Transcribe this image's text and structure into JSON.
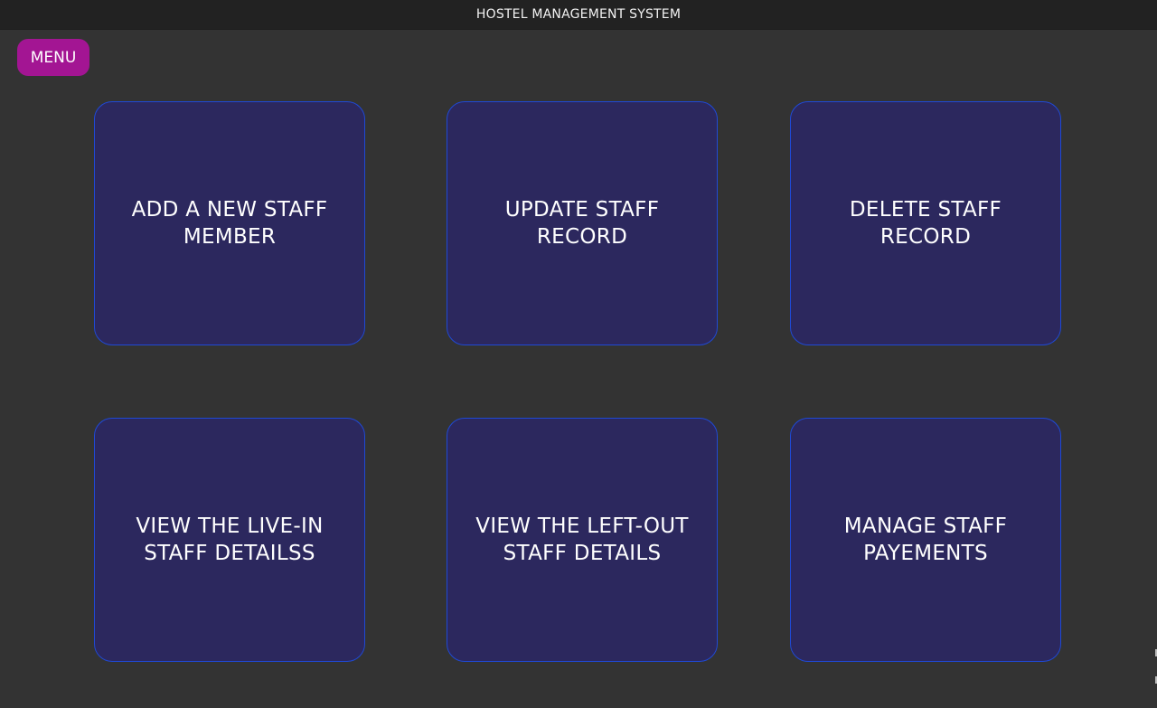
{
  "window": {
    "title": "HOSTEL MANAGEMENT SYSTEM"
  },
  "menu": {
    "label": "MENU"
  },
  "tiles": [
    {
      "label": "ADD A NEW STAFF\n MEMBER"
    },
    {
      "label": "UPDATE STAFF\n RECORD"
    },
    {
      "label": "DELETE STAFF\n RECORD"
    },
    {
      "label": "VIEW THE LIVE-IN\n STAFF DETAILSS"
    },
    {
      "label": "VIEW THE LEFT-OUT\n STAFF DETAILS"
    },
    {
      "label": "MANAGE STAFF\n PAYEMENTS"
    }
  ],
  "colors": {
    "background": "#333333",
    "titlebar": "#222222",
    "menu_button": "#a31593",
    "tile_fill": "#2c285e",
    "tile_border": "#1f49d6"
  }
}
